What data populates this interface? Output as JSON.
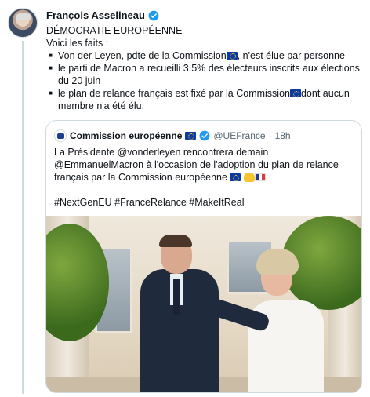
{
  "tweet": {
    "author_name": "François Asselineau",
    "lines": {
      "l1": "DÉMOCRATIE EUROPÉENNE",
      "l2": "Voici les faits :",
      "b1": "Von der Leyen, pdte de la Commission",
      "b1_end": ", n'est élue par personne",
      "b2": "le parti de Macron a recueilli 3,5% des électeurs inscrits aux élections du 20 juin",
      "b3": "le plan de relance français est fixé par la Commission",
      "b3_end": "dont aucun membre n'a été élu."
    }
  },
  "quoted": {
    "author_name": "Commission européenne",
    "handle": "@UEFrance",
    "separator": "·",
    "time": "18h",
    "text": "La Présidente @vonderleyen rencontrera demain @EmmanuelMacron à l'occasion de l'adoption du plan de relance français par la Commission européenne",
    "hashtags": "#NextGenEU #FranceRelance #MakeItReal"
  },
  "colors": {
    "verified": "#1d9bf0",
    "border": "#cfd9de",
    "muted": "#536471"
  },
  "icons": {
    "verified": "verified-badge-icon",
    "eu_flag": "eu-flag-icon",
    "fr_flag": "fr-flag-icon",
    "handshake": "hand-emoji-icon"
  }
}
